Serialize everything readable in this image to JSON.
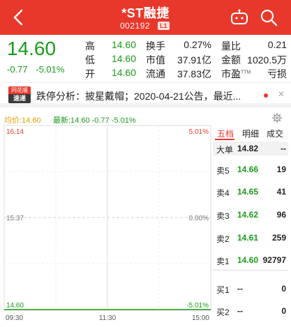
{
  "header": {
    "title": "*ST融捷",
    "code": "002192",
    "level_badge": "L1"
  },
  "quote": {
    "price": "14.60",
    "change": "-0.77",
    "change_pct": "-5.01%",
    "stats": [
      {
        "label": "高",
        "value": "14.60"
      },
      {
        "label": "低",
        "value": "14.60"
      },
      {
        "label": "开",
        "value": "14.60"
      },
      {
        "label": "换手",
        "value": "0.27%"
      },
      {
        "label": "市值",
        "value": "37.91亿"
      },
      {
        "label": "流通",
        "value": "37.83亿"
      },
      {
        "label": "量比",
        "value": "0.21"
      },
      {
        "label": "金额",
        "value": "1020.5万"
      },
      {
        "label": "市盈",
        "value": "亏损",
        "suffix": "TTM"
      }
    ]
  },
  "news": {
    "logo_top": "同花顺",
    "logo_bottom": "速递",
    "text": "跌停分析：披星戴帽；2020-04-21公告，最近..."
  },
  "chart_info": {
    "avg_label": "均价:14.60",
    "latest_label": "最新:14.60 -0.77 -5.01%"
  },
  "chart_data": {
    "type": "line",
    "y_left_ticks": [
      "16.14",
      "15.37",
      "14.60"
    ],
    "y_right_ticks": [
      "5.01%",
      "0.00%",
      "-5.01%"
    ],
    "x_ticks": [
      "09:30",
      "11:30",
      "15:00"
    ],
    "ylim": [
      14.6,
      16.14
    ],
    "series": []
  },
  "orderbook": {
    "tabs": [
      "五档",
      "明细",
      "成交"
    ],
    "big_order": {
      "label": "大单",
      "price": "14.82",
      "vol": "--"
    },
    "asks": [
      {
        "label": "卖5",
        "price": "14.66",
        "vol": "19"
      },
      {
        "label": "卖4",
        "price": "14.65",
        "vol": "41"
      },
      {
        "label": "卖3",
        "price": "14.62",
        "vol": "96"
      },
      {
        "label": "卖2",
        "price": "14.61",
        "vol": "259"
      },
      {
        "label": "卖1",
        "price": "14.60",
        "vol": "92797"
      }
    ],
    "bids": [
      {
        "label": "买1",
        "price": "--",
        "vol": "0"
      },
      {
        "label": "买2",
        "price": "--",
        "vol": "0"
      }
    ]
  },
  "colors": {
    "brand_red": "#e8382c",
    "down_green": "#1a9a1a",
    "avg_yellow": "#e0a000"
  }
}
